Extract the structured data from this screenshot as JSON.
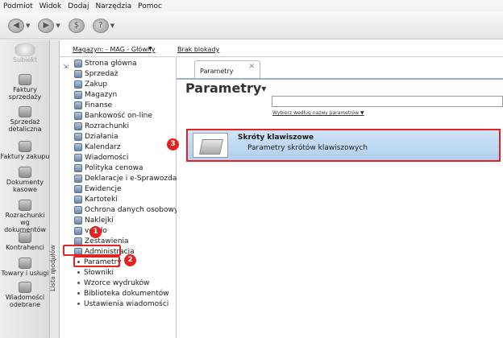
{
  "menu": [
    "Podmiot",
    "Widok",
    "Dodaj",
    "Narzędzia",
    "Pomoc"
  ],
  "toolbar": {
    "icons": [
      "back-icon",
      "forward-icon",
      "money-icon",
      "help-icon"
    ]
  },
  "sidebar": {
    "logo": "Subiekt",
    "items": [
      {
        "label": "Faktury sprzedaży"
      },
      {
        "label": "Sprzedaż detaliczna"
      },
      {
        "label": "Faktury zakupu"
      },
      {
        "label": "Dokumenty kasowe"
      },
      {
        "label": "Rozrachunki wg dokumentów"
      },
      {
        "label": "Kontrahenci"
      },
      {
        "label": "Towary i usługi"
      },
      {
        "label": "Wiadomości odebrane"
      }
    ],
    "tab_label": "Lista modułów"
  },
  "infobar": {
    "magazyn": "Magazyn: - MAG - Główny",
    "lock": "Brak blokady"
  },
  "tree": {
    "items": [
      "Strona główna",
      "Sprzedaż",
      "Zakup",
      "Magazyn",
      "Finanse",
      "Bankowość on-line",
      "Rozrachunki",
      "Działania",
      "Kalendarz",
      "Wiadomości",
      "Polityka cenowa",
      "Deklaracje i e-Sprawozdawczość",
      "Ewidencje",
      "Kartoteki",
      "Ochrona danych osobowych",
      "Naklejki",
      "vendo",
      "Zestawienia",
      "Administracja"
    ],
    "subitems": [
      "Parametry",
      "Słowniki",
      "Wzorce wydruków",
      "Biblioteka dokumentów",
      "Ustawienia wiadomości"
    ]
  },
  "main": {
    "tab_label": "Parametry",
    "title": "Parametry",
    "search_link": "Wybierz według nazwy parametrów",
    "result_title": "Skróty klawiszowe",
    "result_desc": "Parametry skrótów klawiszowych"
  },
  "badges": [
    "1",
    "2",
    "3"
  ]
}
